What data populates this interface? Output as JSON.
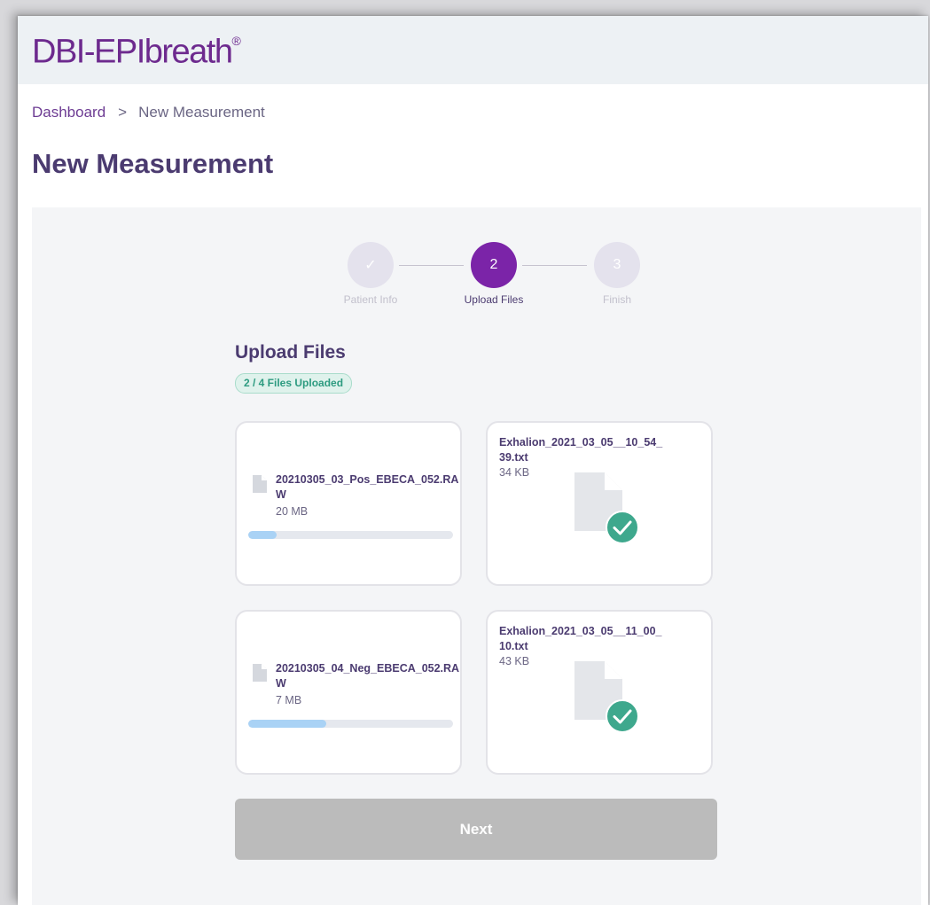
{
  "app": {
    "logo_text": "DBI-EPIbreath",
    "logo_mark": "®",
    "brand_color": "#6d2a8e"
  },
  "breadcrumb": {
    "home": "Dashboard",
    "separator": ">",
    "current": "New Measurement"
  },
  "page": {
    "title": "New Measurement"
  },
  "stepper": {
    "steps": [
      {
        "label": "Patient Info",
        "marker": "✓",
        "state": "done"
      },
      {
        "label": "Upload Files",
        "marker": "2",
        "state": "active"
      },
      {
        "label": "Finish",
        "marker": "3",
        "state": "pending"
      }
    ],
    "active_color": "#7b24a8"
  },
  "upload": {
    "title": "Upload Files",
    "status_badge": "2 / 4 Files Uploaded",
    "files": [
      {
        "name": "20210305_03_Pos_EBECA_052.RAW",
        "size": "20 MB",
        "state": "uploading",
        "progress_percent": 14,
        "icon": "file-icon"
      },
      {
        "name": "Exhalion_2021_03_05__10_54_39.txt",
        "size": "34 KB",
        "state": "uploaded",
        "icon": "file-check-icon"
      },
      {
        "name": "20210305_04_Neg_EBECA_052.RAW",
        "size": "7 MB",
        "state": "uploading",
        "progress_percent": 38,
        "icon": "file-icon"
      },
      {
        "name": "Exhalion_2021_03_05__11_00_10.txt",
        "size": "43 KB",
        "state": "uploaded",
        "icon": "file-check-icon"
      }
    ],
    "success_color": "#3ea88d",
    "progress_color": "#a9d2f5"
  },
  "actions": {
    "next_label": "Next"
  }
}
